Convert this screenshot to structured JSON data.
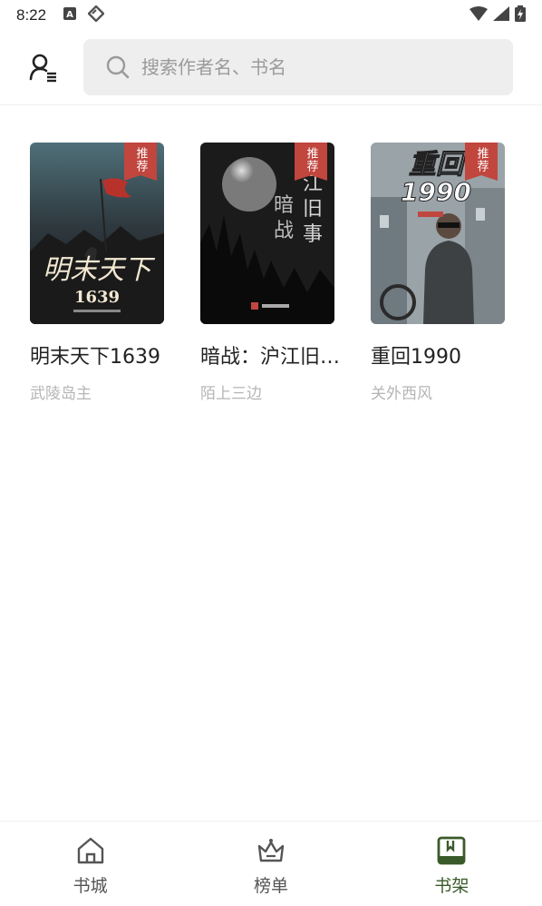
{
  "status_bar": {
    "time": "8:22",
    "left_icons": [
      "a-notification-icon",
      "tag-icon"
    ],
    "right_icons": [
      "wifi-icon",
      "signal-icon",
      "battery-icon"
    ]
  },
  "header": {
    "profile_icon": "user-menu-icon",
    "search": {
      "placeholder": "搜索作者名、书名",
      "value": "",
      "icon": "search-icon"
    }
  },
  "shelf": {
    "books": [
      {
        "title": "明末天下1639",
        "author": "武陵岛主",
        "badge": "推荐",
        "cover_text": "明末天下 1639"
      },
      {
        "title": "暗战：沪江旧…",
        "author": "陌上三边",
        "badge": "推荐",
        "cover_text": "沪江旧事 暗战"
      },
      {
        "title": "重回1990",
        "author": "关外西风",
        "badge": "推荐",
        "cover_text": "重回 1990"
      }
    ]
  },
  "bottom_nav": {
    "items": [
      {
        "label": "书城",
        "icon": "home-icon",
        "active": false
      },
      {
        "label": "榜单",
        "icon": "crown-icon",
        "active": false
      },
      {
        "label": "书架",
        "icon": "bookshelf-icon",
        "active": true
      }
    ]
  },
  "colors": {
    "accent": "#3a5a2a",
    "badge": "#c0463e",
    "search_bg": "#eeeeee",
    "author_gray": "#b5b5b5"
  }
}
